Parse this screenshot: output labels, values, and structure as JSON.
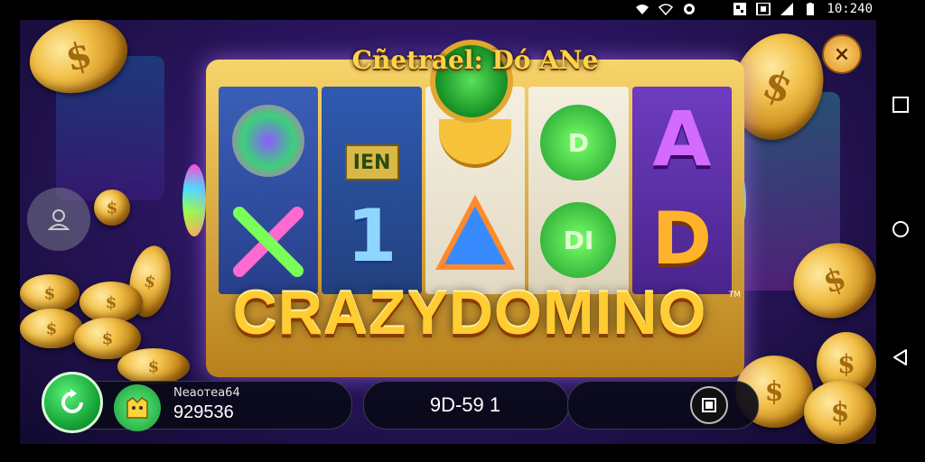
{
  "status_bar": {
    "time": "10:240",
    "icons": [
      "wifi-icon",
      "wifi-calling-icon",
      "sync-icon",
      "qr-icon",
      "nfc-icon",
      "signal-icon",
      "battery-icon"
    ]
  },
  "nav_bar": {
    "icons": [
      "recents-square-icon",
      "home-circle-icon",
      "back-triangle-icon"
    ]
  },
  "game": {
    "banner_title": "Cñetrael: Dó ANe",
    "logo": "CRAZYDOMINO",
    "logo_tm": "TM",
    "reel_symbols": [
      [
        "wheel-symbol",
        "swords-symbol"
      ],
      [
        "IEN",
        "1"
      ],
      [
        "banana-symbol",
        "triangle-symbol"
      ],
      [
        "D",
        "DI"
      ],
      [
        "A",
        "D"
      ]
    ],
    "close_label": "×"
  },
  "bottom_bar": {
    "balance_label": "Nеаотеа64",
    "balance_value": "929536",
    "bet_value": "9D-59 1"
  },
  "colors": {
    "accent_gold": "#ffcc33",
    "button_green": "#18a83a",
    "bg_purple": "#2b1660"
  }
}
